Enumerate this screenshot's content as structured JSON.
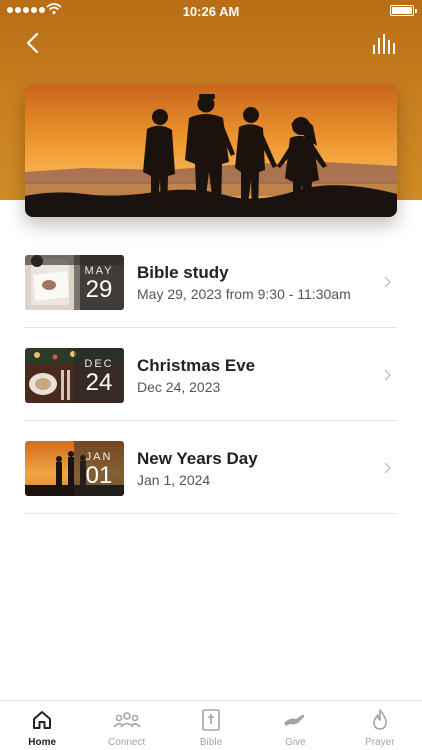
{
  "status_bar": {
    "time": "10:26 AM"
  },
  "header": {
    "back_icon": "chevron-left-icon",
    "audio_icon": "audio-bars-icon"
  },
  "events": [
    {
      "month": "MAY",
      "day": "29",
      "title": "Bible study",
      "subtitle": "May 29, 2023 from 9:30 - 11:30am"
    },
    {
      "month": "DEC",
      "day": "24",
      "title": "Christmas Eve",
      "subtitle": "Dec 24, 2023"
    },
    {
      "month": "JAN",
      "day": "01",
      "title": "New Years Day",
      "subtitle": "Jan 1, 2024"
    }
  ],
  "tabs": [
    {
      "label": "Home",
      "icon": "home-icon",
      "active": true
    },
    {
      "label": "Connect",
      "icon": "people-icon"
    },
    {
      "label": "Bible",
      "icon": "bible-icon"
    },
    {
      "label": "Give",
      "icon": "giving-hand-icon"
    },
    {
      "label": "Prayer",
      "icon": "flame-icon"
    }
  ],
  "colors": {
    "header": "#c47a1c",
    "active_tab": "#222222",
    "inactive_tab": "#a5a5a5"
  }
}
